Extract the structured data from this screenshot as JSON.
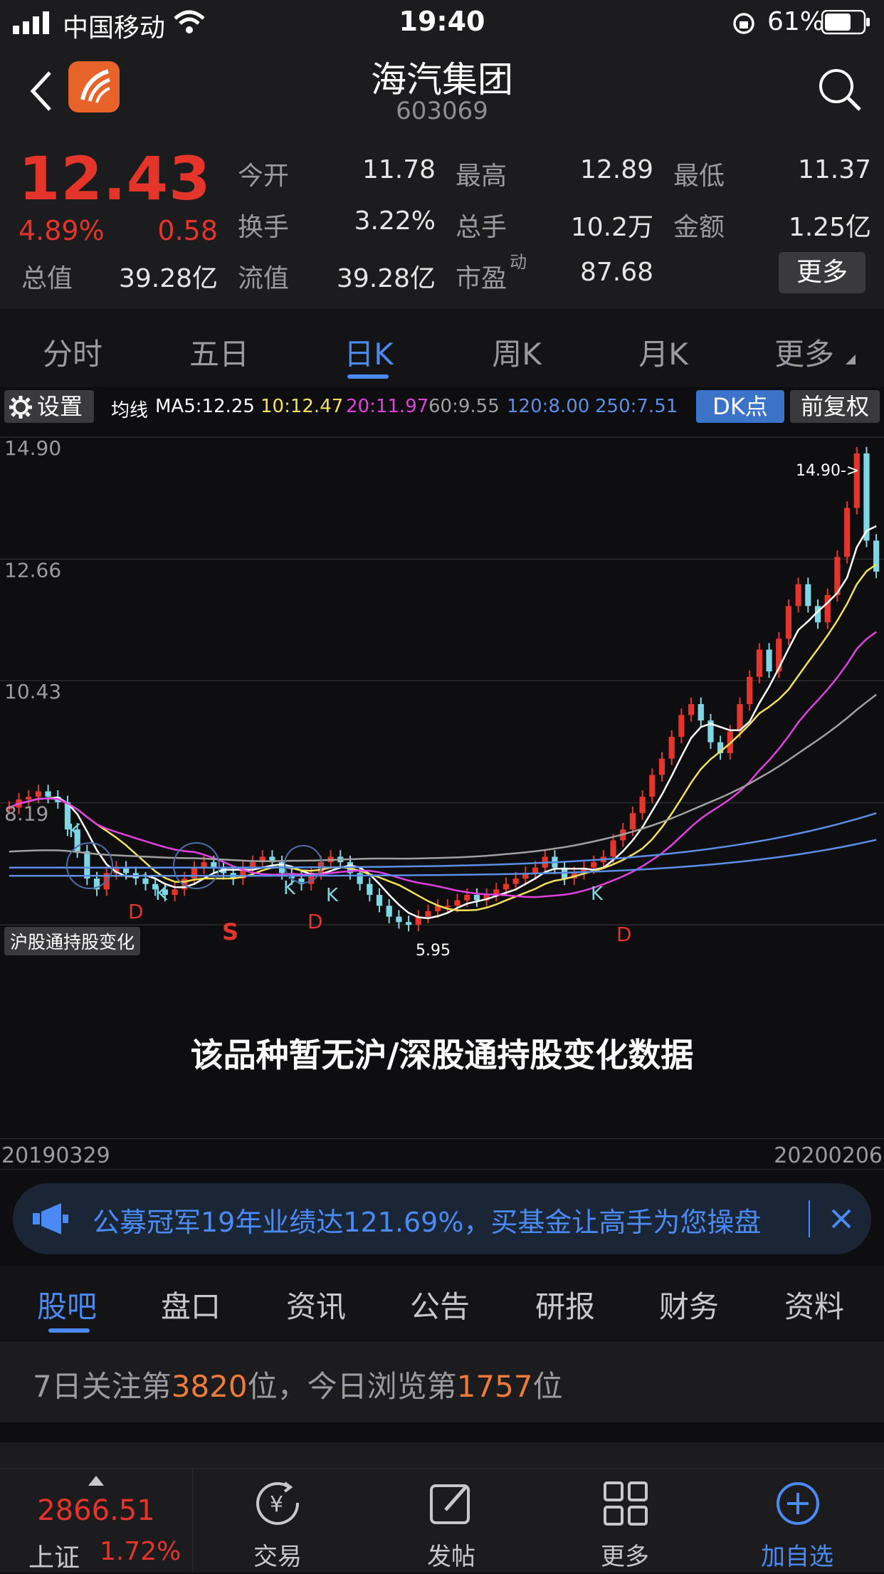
{
  "status_bar": {
    "carrier": "中国移动",
    "time": "19:40",
    "battery": "61%"
  },
  "header": {
    "title": "海汽集团",
    "code": "603069"
  },
  "quote": {
    "price": "12.43",
    "change_pct": "4.89%",
    "change": "0.58",
    "total_value_label": "总值",
    "total_value": "39.28亿",
    "rows": [
      [
        {
          "label": "今开",
          "value": "11.78",
          "color": "#3ec13e"
        },
        {
          "label": "最高",
          "value": "12.89",
          "color": "#e5352b"
        },
        {
          "label": "最低",
          "value": "11.37",
          "color": "#3ec13e"
        }
      ],
      [
        {
          "label": "换手",
          "value": "3.22%",
          "color": "#e6e6e6"
        },
        {
          "label": "总手",
          "value": "10.2万",
          "color": "#e6e6e6"
        },
        {
          "label": "金额",
          "value": "1.25亿",
          "color": "#e6e6e6"
        }
      ],
      [
        {
          "label": "流值",
          "value": "39.28亿",
          "color": "#e6e6e6"
        },
        {
          "label": "市盈",
          "value": "87.68",
          "color": "#e6e6e6"
        }
      ]
    ],
    "pe_sup": "动",
    "more_label": "更多"
  },
  "periods": {
    "tabs": [
      "分时",
      "五日",
      "日K",
      "周K",
      "月K",
      "更多"
    ],
    "active": 2
  },
  "chart": {
    "settings_label": "设置",
    "ma_label": "均线",
    "ma": [
      {
        "text": "MA5:12.25",
        "color": "#ffffff"
      },
      {
        "text": "10:12.47",
        "color": "#f5e05a"
      },
      {
        "text": "20:11.97",
        "color": "#e040e0"
      },
      {
        "text": "60:9.55",
        "color": "#a0a0a0"
      },
      {
        "text": "120:8.00",
        "color": "#5b8ee6"
      },
      {
        "text": "250:7.51",
        "color": "#5b8ee6"
      }
    ],
    "dk_label": "DK点",
    "fq_label": "前复权",
    "y_labels": [
      "14.90",
      "12.66",
      "10.43",
      "8.19",
      "5.95"
    ],
    "high_marker": "14.90->",
    "low_marker": "5.95",
    "markers": [
      "K",
      "K",
      "K",
      "K",
      "K",
      "D",
      "D",
      "D",
      "S"
    ],
    "sub_tag": "沪股通持股变化",
    "no_data_msg": "该品种暂无沪/深股通持股变化数据",
    "start_date": "20190329",
    "end_date": "20200206"
  },
  "chart_data": {
    "type": "candlestick",
    "ylim": [
      5.95,
      14.9
    ],
    "y_ticks": [
      14.9,
      12.66,
      10.43,
      8.19,
      5.95
    ],
    "x_range": [
      "20190329",
      "20200206"
    ],
    "close_series": [
      8.1,
      8.25,
      8.3,
      8.4,
      8.3,
      8.2,
      7.7,
      7.3,
      6.8,
      6.6,
      6.9,
      7.0,
      6.9,
      6.8,
      6.7,
      6.6,
      6.5,
      6.6,
      6.8,
      7.0,
      7.1,
      7.0,
      6.9,
      6.8,
      7.0,
      7.1,
      7.2,
      7.1,
      6.9,
      6.8,
      6.7,
      6.9,
      7.1,
      7.2,
      7.1,
      6.9,
      6.7,
      6.5,
      6.3,
      6.1,
      6.0,
      5.95,
      6.1,
      6.2,
      6.3,
      6.3,
      6.4,
      6.5,
      6.4,
      6.5,
      6.6,
      6.7,
      6.8,
      6.9,
      7.0,
      7.2,
      7.0,
      6.8,
      6.9,
      7.0,
      7.1,
      7.2,
      7.5,
      7.7,
      8.0,
      8.3,
      8.7,
      9.0,
      9.4,
      9.8,
      10.0,
      9.7,
      9.3,
      9.1,
      9.5,
      10.0,
      10.5,
      11.0,
      10.6,
      11.2,
      11.8,
      12.2,
      11.8,
      11.5,
      12.0,
      12.7,
      13.6,
      14.6,
      13.0,
      12.43
    ],
    "ma_lines": [
      {
        "name": "MA5",
        "value": 12.25,
        "color": "#ffffff"
      },
      {
        "name": "MA10",
        "value": 12.47,
        "color": "#f5e05a"
      },
      {
        "name": "MA20",
        "value": 11.97,
        "color": "#e040e0"
      },
      {
        "name": "MA60",
        "value": 9.55,
        "color": "#a0a0a0"
      },
      {
        "name": "MA120",
        "value": 8.0,
        "color": "#5b8ee6"
      },
      {
        "name": "MA250",
        "value": 7.51,
        "color": "#5b8ee6"
      }
    ]
  },
  "announcement": {
    "text": "公募冠军19年业绩达121.69%，买基金让高手为您操盘"
  },
  "bottom_tabs": {
    "tabs": [
      "股吧",
      "盘口",
      "资讯",
      "公告",
      "研报",
      "财务",
      "资料"
    ],
    "active": 0
  },
  "rank": {
    "p1": "7日关注第",
    "n1": "3820",
    "p2": "位，今日浏览第",
    "n2": "1757",
    "p3": "位"
  },
  "nav": {
    "index_value": "2866.51",
    "index_name": "上证",
    "index_change": "1.72%",
    "items": [
      "交易",
      "发帖",
      "更多",
      "加自选"
    ]
  },
  "colors": {
    "up": "#e5352b",
    "down": "#3ec13e",
    "accent": "#4a8af4",
    "rank_num": "#f07a3a"
  }
}
